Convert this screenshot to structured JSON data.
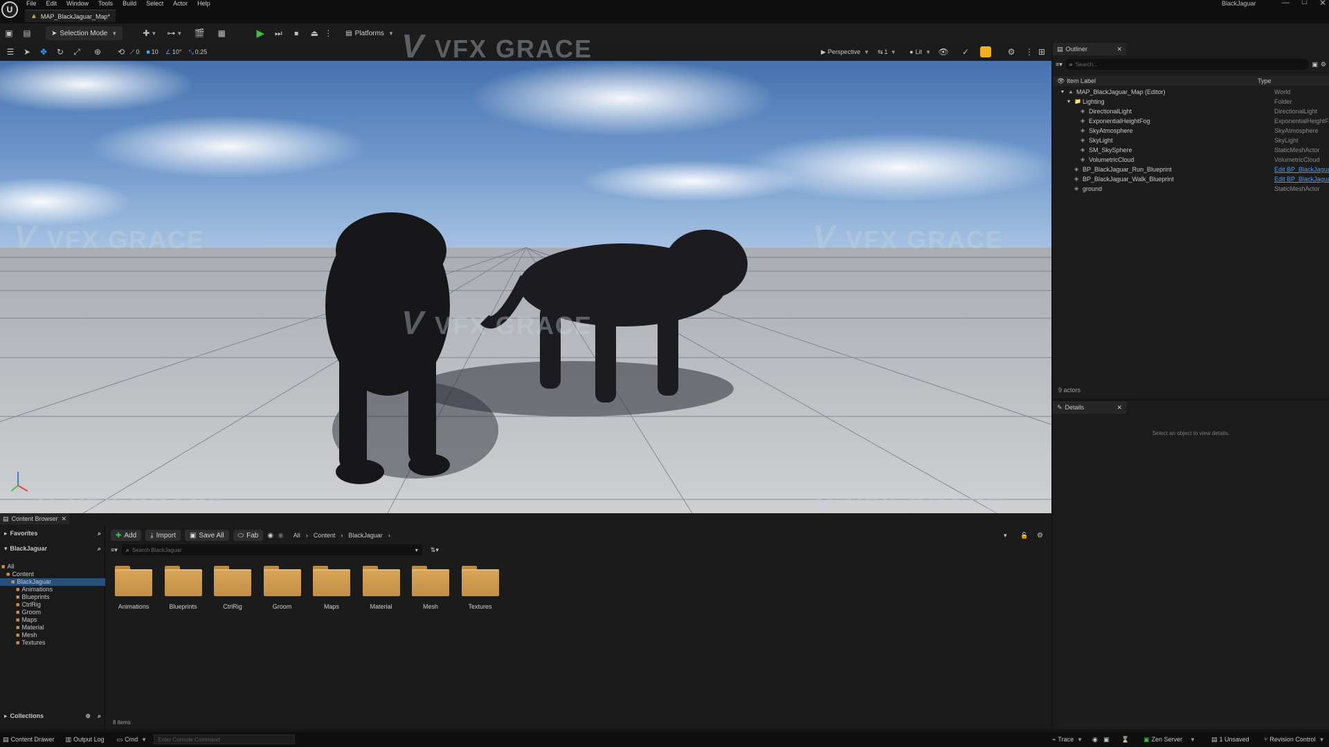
{
  "app": {
    "project_name": "BlackJaguar",
    "map_tab": "MAP_BlackJaguar_Map*"
  },
  "menu": [
    "File",
    "Edit",
    "Window",
    "Tools",
    "Build",
    "Select",
    "Actor",
    "Help"
  ],
  "toolbar": {
    "selection_mode": "Selection Mode",
    "platforms": "Platforms"
  },
  "viewport": {
    "perspective": "Perspective",
    "lit": "Lit",
    "translate_snap": "10",
    "rotate_snap": "10°",
    "scale_snap": "0.25",
    "camera_speed": "1",
    "num_a": "0",
    "num_b": "0"
  },
  "watermark": "VFX GRACE",
  "outliner": {
    "title": "Outliner",
    "search_placeholder": "Search...",
    "col_label": "Item Label",
    "col_type": "Type",
    "rows": [
      {
        "label": "MAP_BlackJaguar_Map (Editor)",
        "type": "World",
        "indent": 0
      },
      {
        "label": "Lighting",
        "type": "Folder",
        "indent": 1
      },
      {
        "label": "DirectionalLight",
        "type": "DirectionalLight",
        "indent": 2
      },
      {
        "label": "ExponentialHeightFog",
        "type": "ExponentialHeightFog",
        "indent": 2
      },
      {
        "label": "SkyAtmosphere",
        "type": "SkyAtmosphere",
        "indent": 2
      },
      {
        "label": "SkyLight",
        "type": "SkyLight",
        "indent": 2
      },
      {
        "label": "SM_SkySphere",
        "type": "StaticMeshActor",
        "indent": 2
      },
      {
        "label": "VolumetricCloud",
        "type": "VolumetricCloud",
        "indent": 2
      },
      {
        "label": "BP_BlackJaguar_Run_Blueprint",
        "type": "Edit BP_BlackJaguar_Run",
        "indent": 1,
        "link": true
      },
      {
        "label": "BP_BlackJaguar_Walk_Blueprint",
        "type": "Edit BP_BlackJaguar_Wa",
        "indent": 1,
        "link": true
      },
      {
        "label": "ground",
        "type": "StaticMeshActor",
        "indent": 1
      }
    ],
    "actors": "9 actors"
  },
  "details": {
    "title": "Details",
    "empty": "Select an object to view details."
  },
  "content_browser": {
    "tab": "Content Browser",
    "favorites": "Favorites",
    "root": "BlackJaguar",
    "add": "Add",
    "import": "Import",
    "save_all": "Save All",
    "fab": "Fab",
    "path": [
      "All",
      "Content",
      "BlackJaguar"
    ],
    "search_placeholder": "Search BlackJaguar",
    "tree": [
      {
        "label": "All",
        "indent": 0
      },
      {
        "label": "Content",
        "indent": 1
      },
      {
        "label": "BlackJaguar",
        "indent": 2,
        "selected": true
      },
      {
        "label": "Animations",
        "indent": 3
      },
      {
        "label": "Blueprints",
        "indent": 3
      },
      {
        "label": "CtrlRig",
        "indent": 3
      },
      {
        "label": "Groom",
        "indent": 3
      },
      {
        "label": "Maps",
        "indent": 3
      },
      {
        "label": "Material",
        "indent": 3
      },
      {
        "label": "Mesh",
        "indent": 3
      },
      {
        "label": "Textures",
        "indent": 3
      }
    ],
    "folders": [
      "Animations",
      "Blueprints",
      "CtrlRig",
      "Groom",
      "Maps",
      "Material",
      "Mesh",
      "Textures"
    ],
    "collections": "Collections",
    "count": "8 items"
  },
  "statusbar": {
    "content_drawer": "Content Drawer",
    "output_log": "Output Log",
    "cmd": "Cmd",
    "console_placeholder": "Enter Console Command",
    "trace": "Trace",
    "zen": "Zen Server",
    "unsaved": "1 Unsaved",
    "revision": "Revision Control"
  }
}
